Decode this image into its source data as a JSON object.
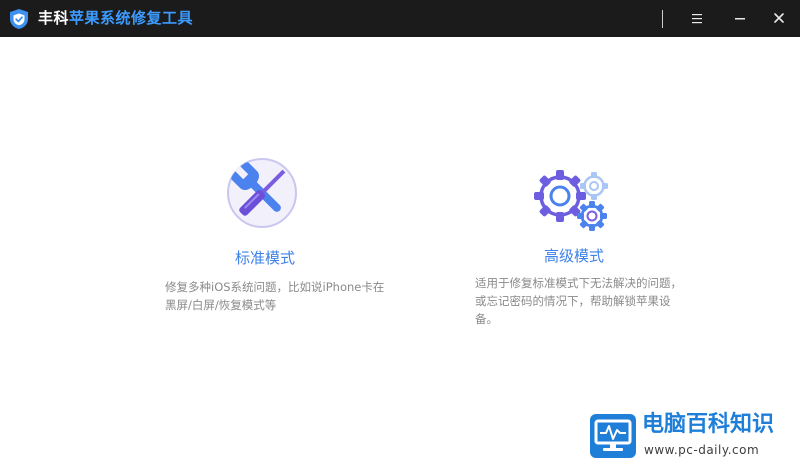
{
  "window": {
    "title_brand": "丰科",
    "title_product": "苹果系统修复工具",
    "controls": {
      "menu": "☰",
      "minimize": "—",
      "close": "✕"
    }
  },
  "modes": [
    {
      "title": "标准模式",
      "desc_line1": "修复多种iOS系统问题，比如说iPhone卡在",
      "desc_line2": "黑屏/白屏/恢复模式等"
    },
    {
      "title": "高级模式",
      "desc_line1": "适用于修复标准模式下无法解决的问题，",
      "desc_line2": "或忘记密码的情况下，帮助解锁苹果设",
      "desc_line3": "备。"
    }
  ],
  "watermark": {
    "name": "电脑百科知识",
    "url": "www.pc-daily.com"
  },
  "colors": {
    "titlebar": "#1b1b1b",
    "accent": "#3d9bff",
    "mode_title": "#3e82e8",
    "watermark_blue": "#1f7fd8"
  }
}
